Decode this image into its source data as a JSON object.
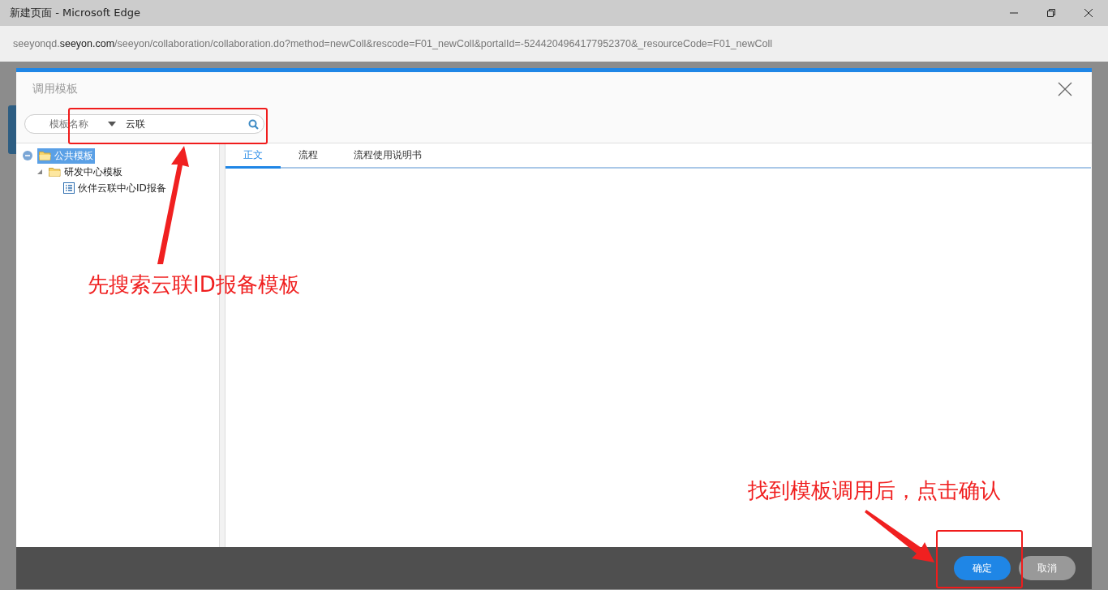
{
  "window": {
    "title": "新建页面 - Microsoft Edge"
  },
  "address_bar": {
    "url": "seeyonqd.**seeyon.com**/seeyon/collaboration/collaboration.do?method=newColl&rescode=F01_newColl&portalId=-5244204964177952370&_resourceCode=F01_newColl"
  },
  "dialog": {
    "title": "调用模板",
    "search": {
      "field": "模板名称",
      "value": "云联"
    },
    "tree": [
      {
        "label": "公共模板",
        "kind": "folder",
        "selected": true,
        "expanded": true,
        "children": [
          {
            "label": "研发中心模板",
            "kind": "folder",
            "selected": false,
            "expanded": true,
            "children": [
              {
                "label": "伙伴云联中心ID报备",
                "kind": "template",
                "selected": false
              }
            ]
          }
        ]
      }
    ],
    "tabs": [
      {
        "label": "正文",
        "selected": true
      },
      {
        "label": "流程",
        "selected": false
      },
      {
        "label": "流程使用说明书",
        "selected": false
      }
    ],
    "buttons": [
      {
        "label": "确定",
        "kind": "primary"
      },
      {
        "label": "取消",
        "kind": "secondary"
      }
    ]
  },
  "annotations": [
    {
      "text": "先搜索云联ID报备模板"
    },
    {
      "text": "找到模板调用后，点击确认"
    }
  ]
}
